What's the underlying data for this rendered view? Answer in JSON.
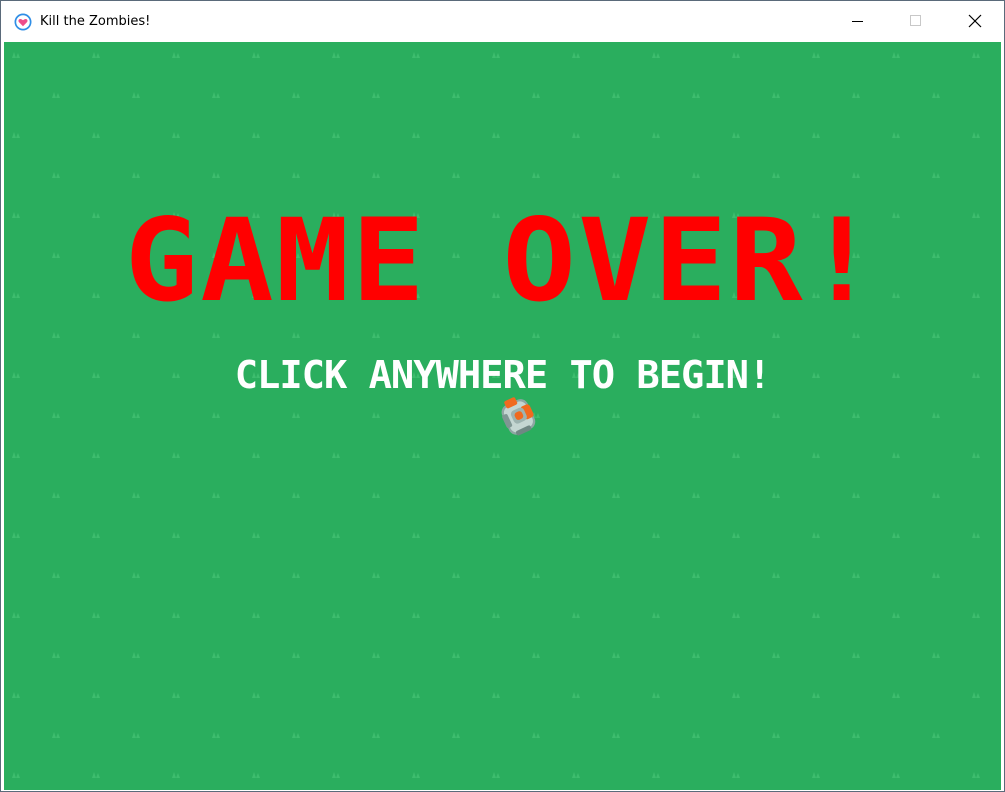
{
  "window": {
    "title": "Kill the Zombies!",
    "app_icon": "heart-app-icon",
    "controls": {
      "minimize_icon": "minimize-icon",
      "maximize_icon": "maximize-icon",
      "close_icon": "close-icon"
    }
  },
  "game": {
    "background_color": "#2aae5e",
    "grass_color": "#3dbd6e",
    "headline": "GAME OVER!",
    "headline_color": "#ff0000",
    "prompt": "CLICK ANYWHERE TO BEGIN!",
    "prompt_color": "#ffffff",
    "player_sprite": "player-robot-sprite"
  }
}
